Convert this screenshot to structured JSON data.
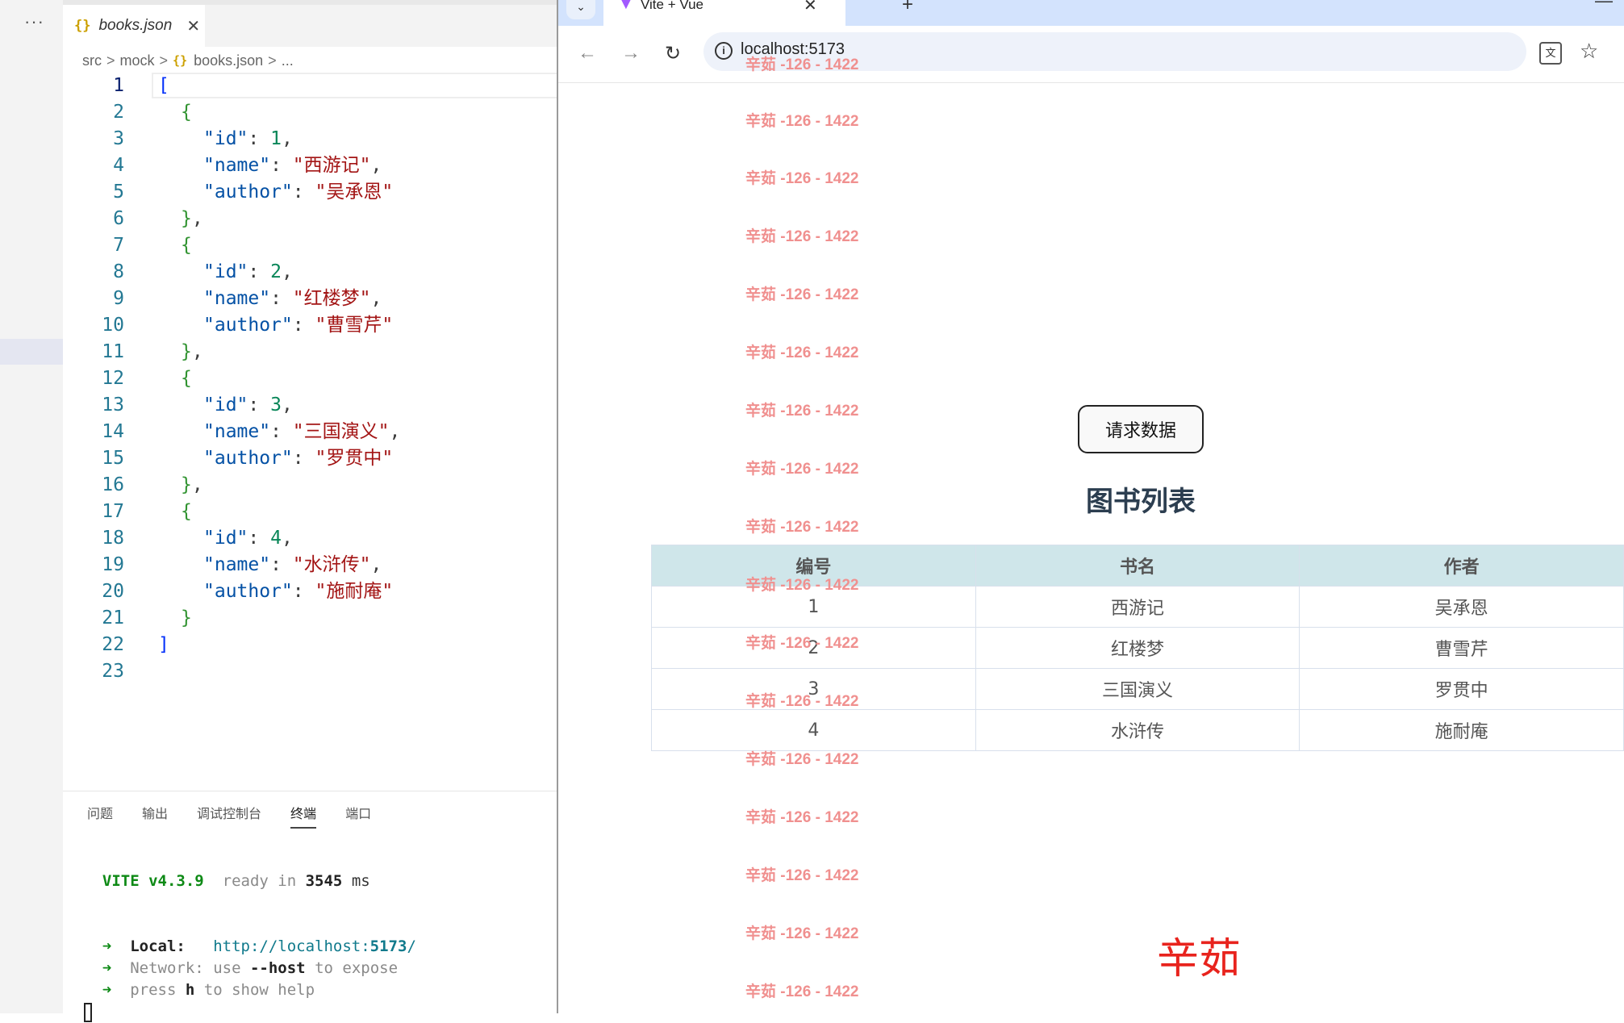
{
  "vscode": {
    "more_label": "···",
    "tab": {
      "title": "books.json",
      "icon": "{}",
      "close": "✕"
    },
    "breadcrumb": [
      "src",
      "mock",
      "books.json",
      "..."
    ],
    "breadcrumb_sep": ">",
    "code_lines": [
      "1",
      "2",
      "3",
      "4",
      "5",
      "6",
      "7",
      "8",
      "9",
      "10",
      "11",
      "12",
      "13",
      "14",
      "15",
      "16",
      "17",
      "18",
      "19",
      "20",
      "21",
      "22",
      "23"
    ],
    "books": [
      {
        "id": "1",
        "name": "\"西游记\"",
        "author": "\"吴承恩\""
      },
      {
        "id": "2",
        "name": "\"红楼梦\"",
        "author": "\"曹雪芹\""
      },
      {
        "id": "3",
        "name": "\"三国演义\"",
        "author": "\"罗贯中\""
      },
      {
        "id": "4",
        "name": "\"水浒传\"",
        "author": "\"施耐庵\""
      }
    ],
    "json_keys": {
      "id": "\"id\"",
      "name": "\"name\"",
      "author": "\"author\""
    },
    "panel_tabs": [
      "问题",
      "输出",
      "调试控制台",
      "终端",
      "端口"
    ],
    "panel_active": "终端",
    "terminal": {
      "vite": "VITE v4.3.9",
      "ready": "ready in",
      "ms_value": "3545",
      "ms": "ms",
      "arrow": "➜",
      "local_label": "Local:",
      "local_url_prefix": "http://localhost:",
      "local_port": "5173",
      "local_url_suffix": "/",
      "network_label": "Network:",
      "network_use": "use",
      "network_flag": "--host",
      "network_rest": "to expose",
      "press": "press",
      "press_key": "h",
      "press_rest": "to show help"
    }
  },
  "browser": {
    "tab_title": "Vite + Vue",
    "tab_close": "✕",
    "new_tab": "+",
    "minimize": "—",
    "url": "localhost:5173",
    "watermark": "辛茹 -126 - 1422",
    "request_button": "请求数据",
    "list_title": "图书列表",
    "table": {
      "headers": [
        "编号",
        "书名",
        "作者"
      ],
      "rows": [
        [
          "1",
          "西游记",
          "吴承恩"
        ],
        [
          "2",
          "红楼梦",
          "曹雪芹"
        ],
        [
          "3",
          "三国演义",
          "罗贯中"
        ],
        [
          "4",
          "水浒传",
          "施耐庵"
        ]
      ]
    },
    "signature": "辛茹"
  }
}
